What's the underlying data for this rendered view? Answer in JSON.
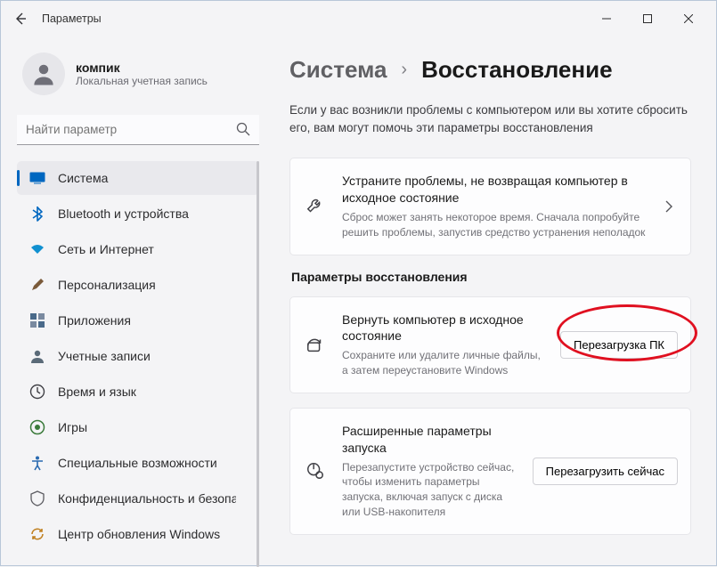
{
  "window": {
    "title": "Параметры"
  },
  "account": {
    "name": "компик",
    "type": "Локальная учетная запись"
  },
  "search": {
    "placeholder": "Найти параметр"
  },
  "sidebar": {
    "items": [
      {
        "label": "Система"
      },
      {
        "label": "Bluetooth и устройства"
      },
      {
        "label": "Сеть и Интернет"
      },
      {
        "label": "Персонализация"
      },
      {
        "label": "Приложения"
      },
      {
        "label": "Учетные записи"
      },
      {
        "label": "Время и язык"
      },
      {
        "label": "Игры"
      },
      {
        "label": "Специальные возможности"
      },
      {
        "label": "Конфиденциальность и безопасность"
      },
      {
        "label": "Центр обновления Windows"
      }
    ]
  },
  "main": {
    "breadcrumb_parent": "Система",
    "breadcrumb_sep": "›",
    "breadcrumb_current": "Восстановление",
    "intro": "Если у вас возникли проблемы с компьютером или вы хотите сбросить его, вам могут помочь эти параметры восстановления",
    "troubleshoot": {
      "title": "Устраните проблемы, не возвращая компьютер в исходное состояние",
      "sub": "Сброс может занять некоторое время. Сначала попробуйте решить проблемы, запустив средство устранения неполадок"
    },
    "section_label": "Параметры восстановления",
    "reset": {
      "title": "Вернуть компьютер в исходное состояние",
      "sub": "Сохраните или удалите личные файлы, а затем переустановите Windows",
      "button": "Перезагрузка ПК"
    },
    "advanced": {
      "title": "Расширенные параметры запуска",
      "sub": "Перезапустите устройство сейчас, чтобы изменить параметры запуска, включая запуск с диска или USB-накопителя",
      "button": "Перезагрузить сейчас"
    }
  }
}
